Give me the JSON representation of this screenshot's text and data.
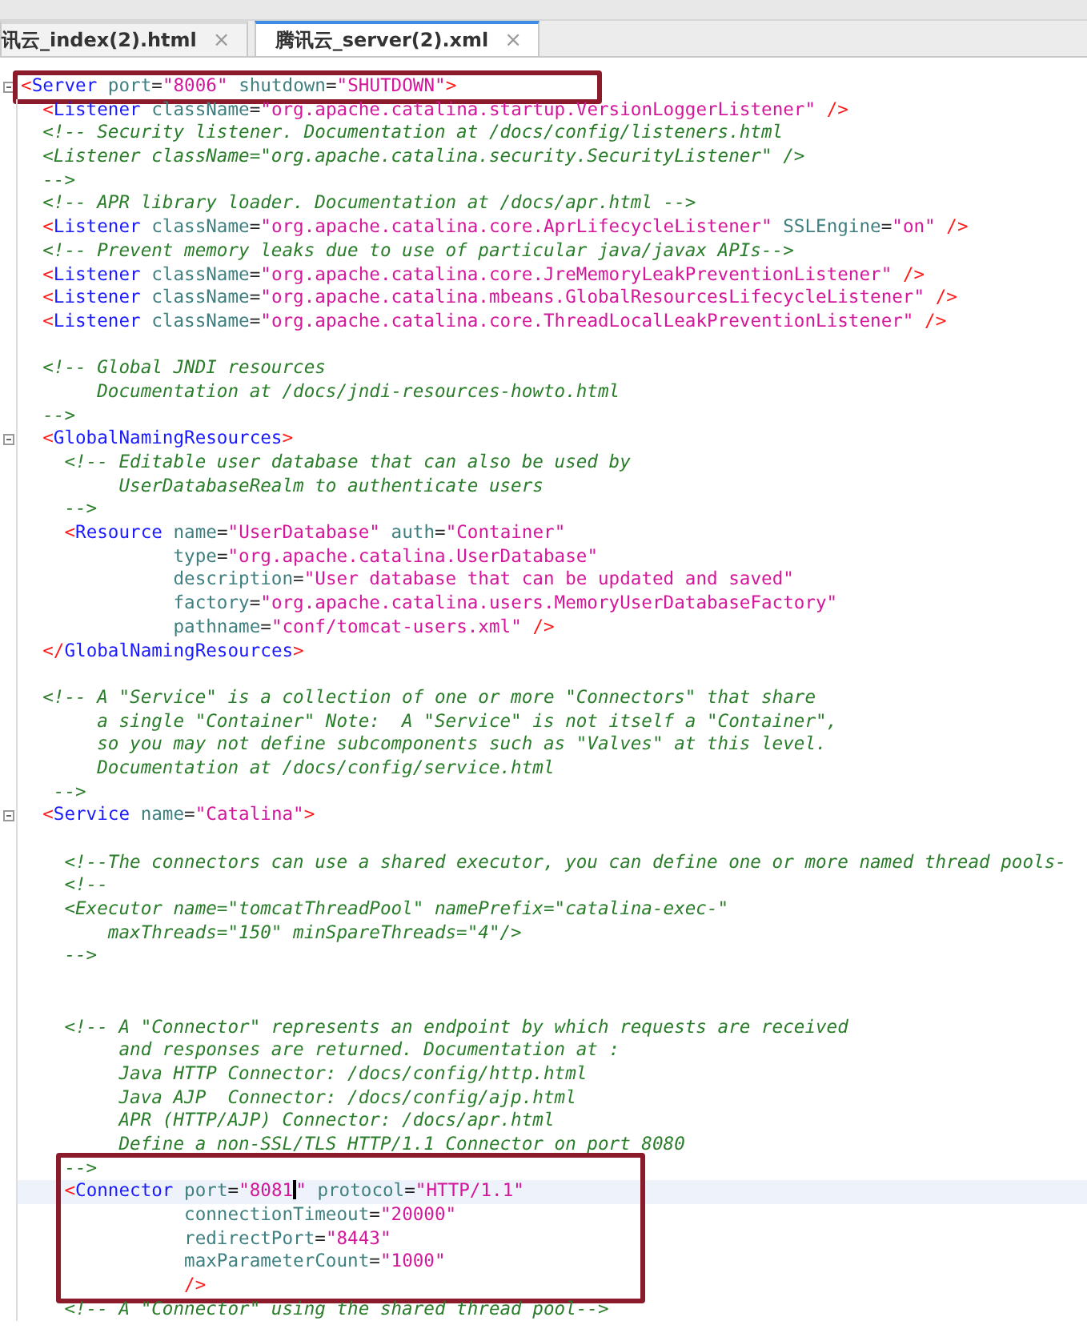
{
  "tabs": [
    {
      "label": "讯云_index(2).html",
      "close": "×",
      "selected": false
    },
    {
      "label": "腾讯云_server(2).xml",
      "close": "×",
      "selected": true
    }
  ],
  "editor": {
    "blocks": [
      {
        "highlighted": true,
        "lines": [
          {
            "foldable": true,
            "tokens": [
              {
                "kind": "bracket",
                "text": "<"
              },
              {
                "kind": "tag",
                "text": "Server"
              },
              {
                "kind": "attr",
                "text": " port"
              },
              {
                "kind": "eq",
                "text": "="
              },
              {
                "kind": "value",
                "text": "\"8006\""
              },
              {
                "kind": "attr",
                "text": " shutdown"
              },
              {
                "kind": "eq",
                "text": "="
              },
              {
                "kind": "value",
                "text": "\"SHUTDOWN\""
              },
              {
                "kind": "bracket",
                "text": ">"
              }
            ]
          }
        ]
      },
      {
        "highlighted": false,
        "lines": [
          {
            "tokens": [
              {
                "kind": "bracket",
                "text": "  <"
              },
              {
                "kind": "tag",
                "text": "Listener"
              },
              {
                "kind": "attr",
                "text": " className"
              },
              {
                "kind": "eq",
                "text": "="
              },
              {
                "kind": "value",
                "text": "\"org.apache.catalina.startup.VersionLoggerListener\""
              },
              {
                "kind": "bracket",
                "text": " />"
              }
            ]
          },
          {
            "tokens": [
              {
                "kind": "comment",
                "text": "  <!-- Security listener. Documentation at /docs/config/listeners.html"
              }
            ]
          },
          {
            "tokens": [
              {
                "kind": "comment",
                "text": "  <Listener className=\"org.apache.catalina.security.SecurityListener\" />"
              }
            ]
          },
          {
            "tokens": [
              {
                "kind": "comment",
                "text": "  -->"
              }
            ]
          },
          {
            "tokens": [
              {
                "kind": "comment",
                "text": "  <!-- APR library loader. Documentation at /docs/apr.html -->"
              }
            ]
          },
          {
            "tokens": [
              {
                "kind": "bracket",
                "text": "  <"
              },
              {
                "kind": "tag",
                "text": "Listener"
              },
              {
                "kind": "attr",
                "text": " className"
              },
              {
                "kind": "eq",
                "text": "="
              },
              {
                "kind": "value",
                "text": "\"org.apache.catalina.core.AprLifecycleListener\""
              },
              {
                "kind": "attr",
                "text": " SSLEngine"
              },
              {
                "kind": "eq",
                "text": "="
              },
              {
                "kind": "value",
                "text": "\"on\""
              },
              {
                "kind": "bracket",
                "text": " />"
              }
            ]
          },
          {
            "tokens": [
              {
                "kind": "comment",
                "text": "  <!-- Prevent memory leaks due to use of particular java/javax APIs-->"
              }
            ]
          },
          {
            "tokens": [
              {
                "kind": "bracket",
                "text": "  <"
              },
              {
                "kind": "tag",
                "text": "Listener"
              },
              {
                "kind": "attr",
                "text": " className"
              },
              {
                "kind": "eq",
                "text": "="
              },
              {
                "kind": "value",
                "text": "\"org.apache.catalina.core.JreMemoryLeakPreventionListener\""
              },
              {
                "kind": "bracket",
                "text": " />"
              }
            ]
          },
          {
            "tokens": [
              {
                "kind": "bracket",
                "text": "  <"
              },
              {
                "kind": "tag",
                "text": "Listener"
              },
              {
                "kind": "attr",
                "text": " className"
              },
              {
                "kind": "eq",
                "text": "="
              },
              {
                "kind": "value",
                "text": "\"org.apache.catalina.mbeans.GlobalResourcesLifecycleListener\""
              },
              {
                "kind": "bracket",
                "text": " />"
              }
            ]
          },
          {
            "tokens": [
              {
                "kind": "bracket",
                "text": "  <"
              },
              {
                "kind": "tag",
                "text": "Listener"
              },
              {
                "kind": "attr",
                "text": " className"
              },
              {
                "kind": "eq",
                "text": "="
              },
              {
                "kind": "value",
                "text": "\"org.apache.catalina.core.ThreadLocalLeakPreventionListener\""
              },
              {
                "kind": "bracket",
                "text": " />"
              }
            ]
          },
          {
            "blank": true
          },
          {
            "tokens": [
              {
                "kind": "comment",
                "text": "  <!-- Global JNDI resources"
              }
            ]
          },
          {
            "tokens": [
              {
                "kind": "comment",
                "text": "       Documentation at /docs/jndi-resources-howto.html"
              }
            ]
          },
          {
            "tokens": [
              {
                "kind": "comment",
                "text": "  -->"
              }
            ]
          },
          {
            "foldable": true,
            "tokens": [
              {
                "kind": "bracket",
                "text": "  <"
              },
              {
                "kind": "tag",
                "text": "GlobalNamingResources"
              },
              {
                "kind": "bracket",
                "text": ">"
              }
            ]
          },
          {
            "tokens": [
              {
                "kind": "comment",
                "text": "    <!-- Editable user database that can also be used by"
              }
            ]
          },
          {
            "tokens": [
              {
                "kind": "comment",
                "text": "         UserDatabaseRealm to authenticate users"
              }
            ]
          },
          {
            "tokens": [
              {
                "kind": "comment",
                "text": "    -->"
              }
            ]
          },
          {
            "tokens": [
              {
                "kind": "bracket",
                "text": "    <"
              },
              {
                "kind": "tag",
                "text": "Resource"
              },
              {
                "kind": "attr",
                "text": " name"
              },
              {
                "kind": "eq",
                "text": "="
              },
              {
                "kind": "value",
                "text": "\"UserDatabase\""
              },
              {
                "kind": "attr",
                "text": " auth"
              },
              {
                "kind": "eq",
                "text": "="
              },
              {
                "kind": "value",
                "text": "\"Container\""
              }
            ]
          },
          {
            "tokens": [
              {
                "kind": "attr",
                "text": "              type"
              },
              {
                "kind": "eq",
                "text": "="
              },
              {
                "kind": "value",
                "text": "\"org.apache.catalina.UserDatabase\""
              }
            ]
          },
          {
            "tokens": [
              {
                "kind": "attr",
                "text": "              description"
              },
              {
                "kind": "eq",
                "text": "="
              },
              {
                "kind": "value",
                "text": "\"User database that can be updated and saved\""
              }
            ]
          },
          {
            "tokens": [
              {
                "kind": "attr",
                "text": "              factory"
              },
              {
                "kind": "eq",
                "text": "="
              },
              {
                "kind": "value",
                "text": "\"org.apache.catalina.users.MemoryUserDatabaseFactory\""
              }
            ]
          },
          {
            "tokens": [
              {
                "kind": "attr",
                "text": "              pathname"
              },
              {
                "kind": "eq",
                "text": "="
              },
              {
                "kind": "value",
                "text": "\"conf/tomcat-users.xml\""
              },
              {
                "kind": "bracket",
                "text": " />"
              }
            ]
          },
          {
            "tokens": [
              {
                "kind": "bracket",
                "text": "  </"
              },
              {
                "kind": "tag",
                "text": "GlobalNamingResources"
              },
              {
                "kind": "bracket",
                "text": ">"
              }
            ]
          },
          {
            "blank": true
          },
          {
            "tokens": [
              {
                "kind": "comment",
                "text": "  <!-- A \"Service\" is a collection of one or more \"Connectors\" that share"
              }
            ]
          },
          {
            "tokens": [
              {
                "kind": "comment",
                "text": "       a single \"Container\" Note:  A \"Service\" is not itself a \"Container\","
              }
            ]
          },
          {
            "tokens": [
              {
                "kind": "comment",
                "text": "       so you may not define subcomponents such as \"Valves\" at this level."
              }
            ]
          },
          {
            "tokens": [
              {
                "kind": "comment",
                "text": "       Documentation at /docs/config/service.html"
              }
            ]
          },
          {
            "tokens": [
              {
                "kind": "comment",
                "text": "   -->"
              }
            ]
          },
          {
            "foldable": true,
            "tokens": [
              {
                "kind": "bracket",
                "text": "  <"
              },
              {
                "kind": "tag",
                "text": "Service"
              },
              {
                "kind": "attr",
                "text": " name"
              },
              {
                "kind": "eq",
                "text": "="
              },
              {
                "kind": "value",
                "text": "\"Catalina\""
              },
              {
                "kind": "bracket",
                "text": ">"
              }
            ]
          },
          {
            "blank": true
          },
          {
            "tokens": [
              {
                "kind": "comment",
                "text": "    <!--The connectors can use a shared executor, you can define one or more named thread pools-"
              }
            ]
          },
          {
            "tokens": [
              {
                "kind": "comment",
                "text": "    <!--"
              }
            ]
          },
          {
            "tokens": [
              {
                "kind": "comment",
                "text": "    <Executor name=\"tomcatThreadPool\" namePrefix=\"catalina-exec-\""
              }
            ]
          },
          {
            "tokens": [
              {
                "kind": "comment",
                "text": "        maxThreads=\"150\" minSpareThreads=\"4\"/>"
              }
            ]
          },
          {
            "tokens": [
              {
                "kind": "comment",
                "text": "    -->"
              }
            ]
          },
          {
            "blank": true
          },
          {
            "blank": true
          },
          {
            "tokens": [
              {
                "kind": "comment",
                "text": "    <!-- A \"Connector\" represents an endpoint by which requests are received"
              }
            ]
          },
          {
            "tokens": [
              {
                "kind": "comment",
                "text": "         and responses are returned. Documentation at :"
              }
            ]
          },
          {
            "tokens": [
              {
                "kind": "comment",
                "text": "         Java HTTP Connector: /docs/config/http.html"
              }
            ]
          },
          {
            "tokens": [
              {
                "kind": "comment",
                "text": "         Java AJP  Connector: /docs/config/ajp.html"
              }
            ]
          },
          {
            "tokens": [
              {
                "kind": "comment",
                "text": "         APR (HTTP/AJP) Connector: /docs/apr.html"
              }
            ]
          },
          {
            "tokens": [
              {
                "kind": "comment",
                "text": "         Define a non-SSL/TLS HTTP/1.1 Connector on port 8080"
              }
            ]
          }
        ]
      },
      {
        "highlighted": true,
        "lines": [
          {
            "tokens": [
              {
                "kind": "comment",
                "text": "    -->"
              }
            ]
          },
          {
            "current": true,
            "tokens": [
              {
                "kind": "bracket",
                "text": "    <"
              },
              {
                "kind": "tag",
                "text": "Connector"
              },
              {
                "kind": "attr",
                "text": " port"
              },
              {
                "kind": "eq",
                "text": "="
              },
              {
                "kind": "value",
                "text": "\"8081"
              },
              {
                "kind": "cursor"
              },
              {
                "kind": "value",
                "text": "\""
              },
              {
                "kind": "attr",
                "text": " protocol"
              },
              {
                "kind": "eq",
                "text": "="
              },
              {
                "kind": "value",
                "text": "\"HTTP/1.1\""
              }
            ]
          },
          {
            "tokens": [
              {
                "kind": "attr",
                "text": "               connectionTimeout"
              },
              {
                "kind": "eq",
                "text": "="
              },
              {
                "kind": "value",
                "text": "\"20000\""
              }
            ]
          },
          {
            "tokens": [
              {
                "kind": "attr",
                "text": "               redirectPort"
              },
              {
                "kind": "eq",
                "text": "="
              },
              {
                "kind": "value",
                "text": "\"8443\""
              }
            ]
          },
          {
            "tokens": [
              {
                "kind": "attr",
                "text": "               maxParameterCount"
              },
              {
                "kind": "eq",
                "text": "="
              },
              {
                "kind": "value",
                "text": "\"1000\""
              }
            ]
          },
          {
            "tokens": [
              {
                "kind": "bracket",
                "text": "               />"
              }
            ]
          }
        ]
      },
      {
        "highlighted": false,
        "lines": [
          {
            "tokens": [
              {
                "kind": "comment",
                "text": "    <!-- A \"Connector\" using the shared thread pool-->"
              }
            ]
          }
        ]
      }
    ]
  }
}
